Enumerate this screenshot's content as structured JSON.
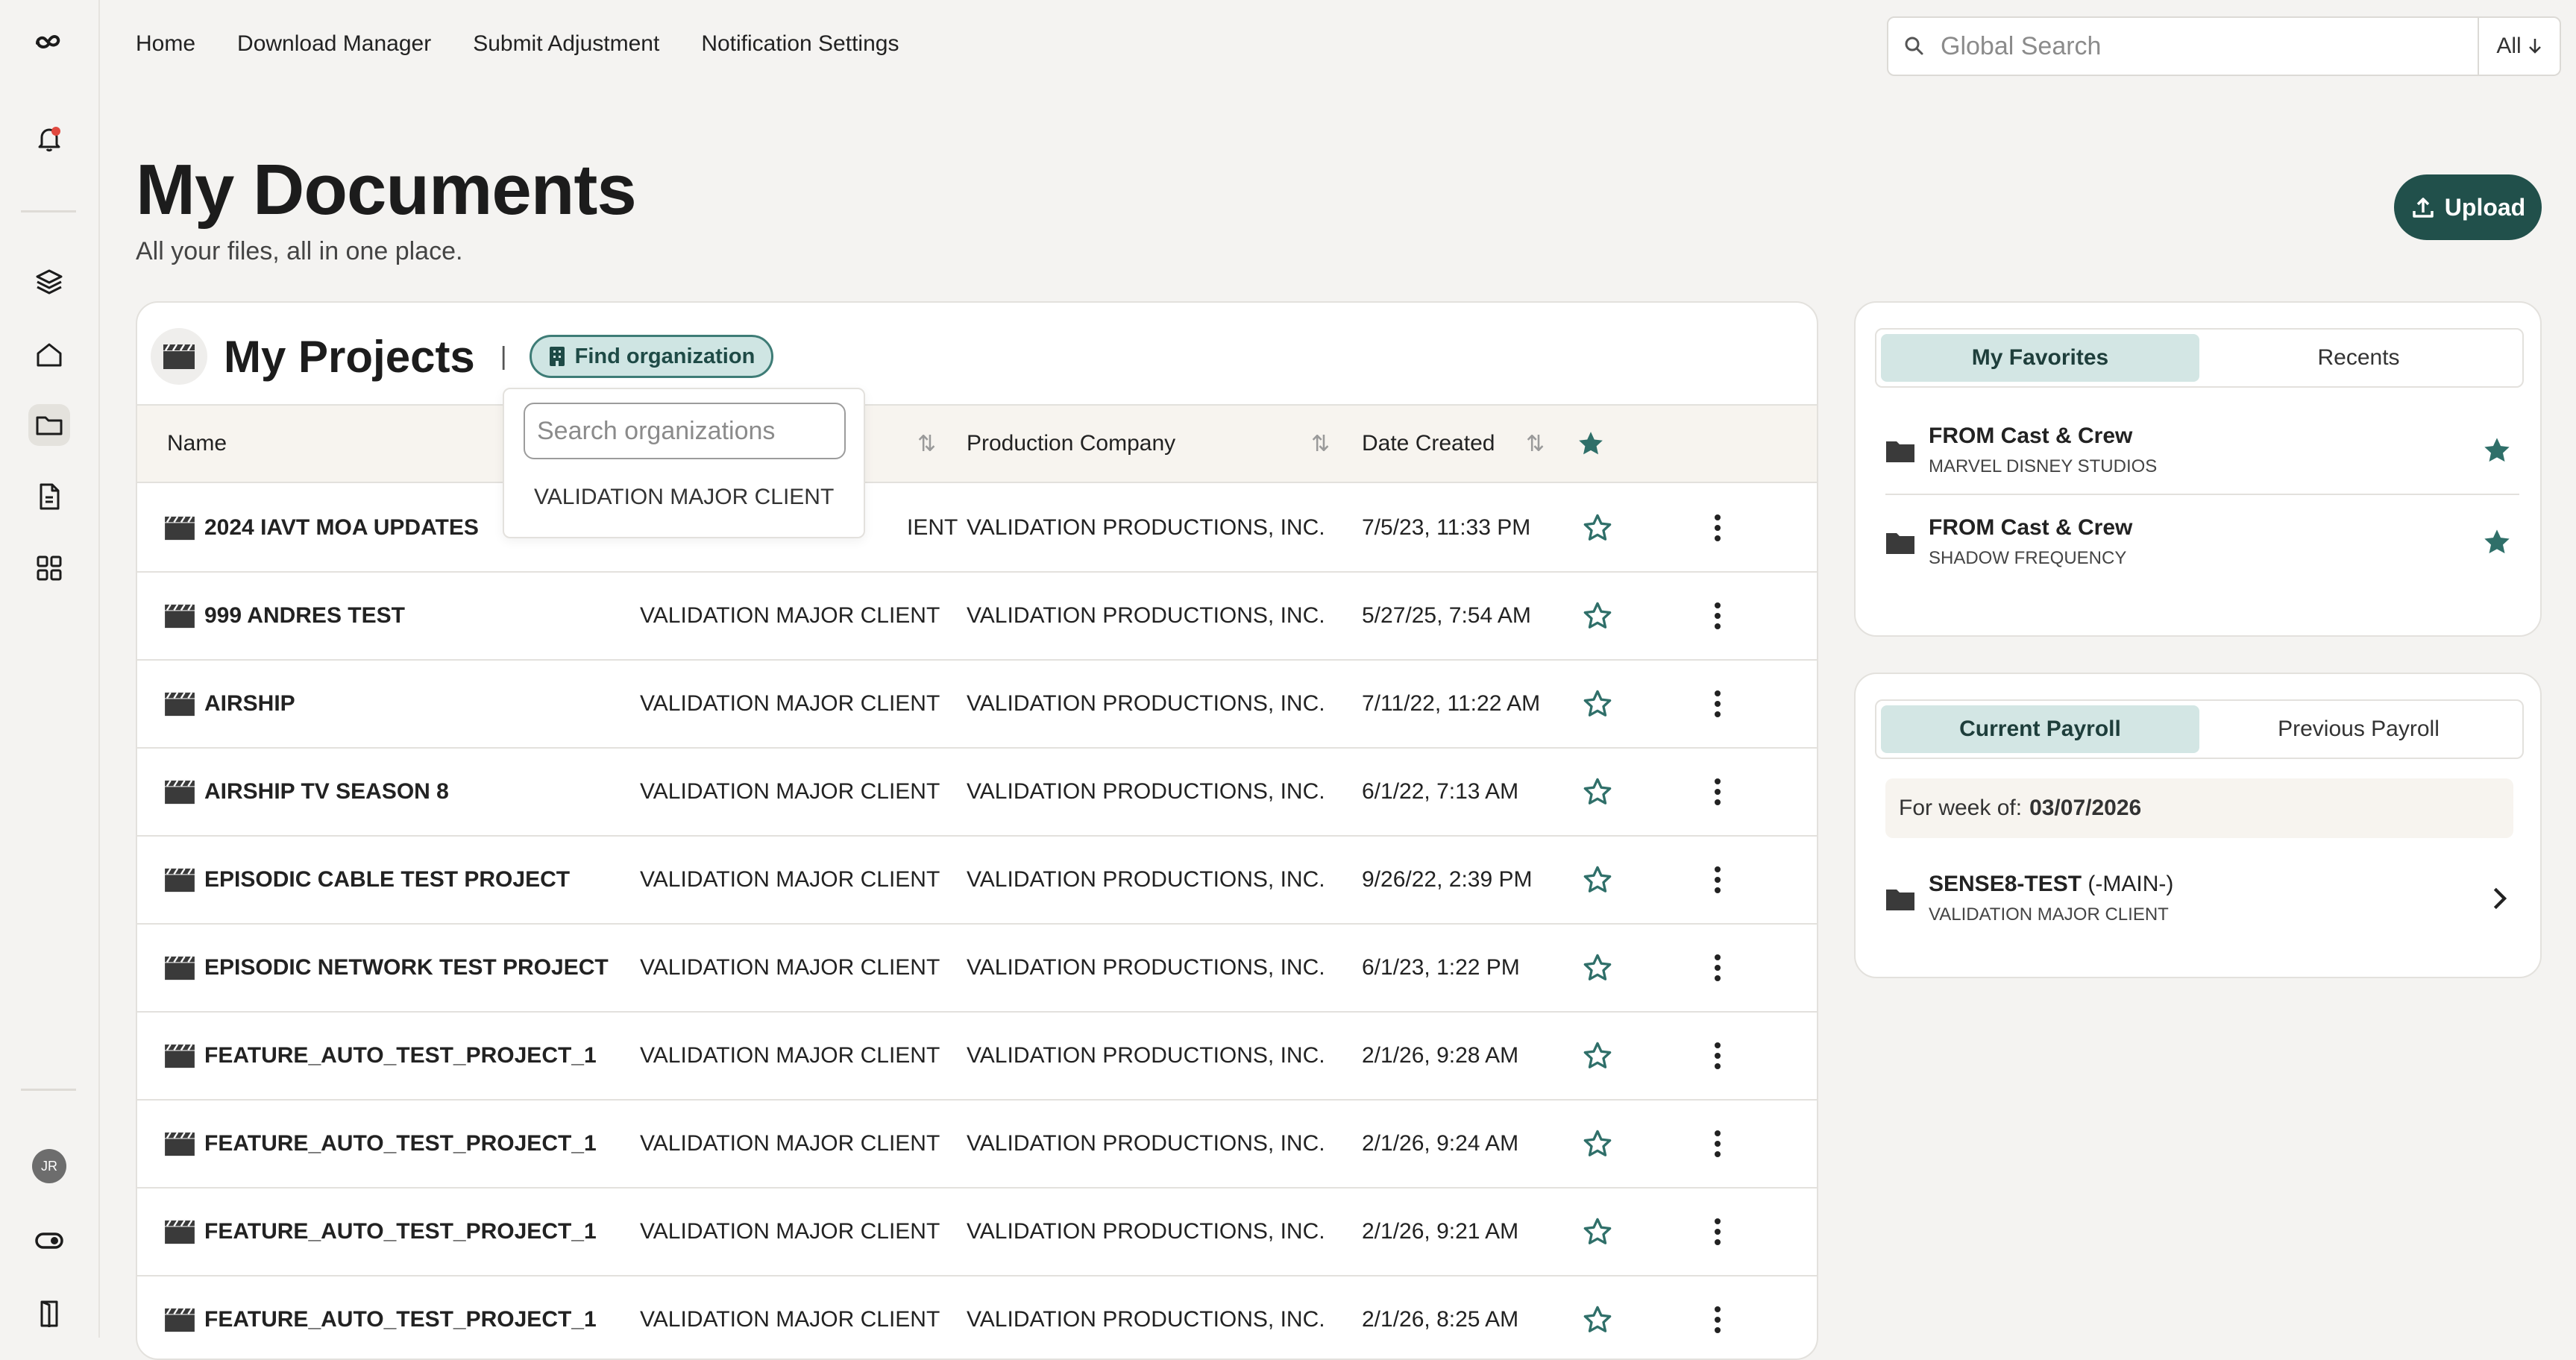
{
  "nav": {
    "items": [
      "Home",
      "Download Manager",
      "Submit Adjustment",
      "Notification Settings"
    ]
  },
  "search": {
    "placeholder": "Global Search",
    "scope": "All"
  },
  "header": {
    "title": "My Documents",
    "subtitle": "All your files, all in one place.",
    "upload_label": "Upload"
  },
  "user": {
    "initials": "JR"
  },
  "projects": {
    "title": "My Projects",
    "find_org_label": "Find organization",
    "dropdown": {
      "placeholder": "Search organizations",
      "options": [
        "VALIDATION MAJOR CLIENT"
      ]
    },
    "columns": {
      "name": "Name",
      "production_company": "Production Company",
      "date_created": "Date Created"
    },
    "rows": [
      {
        "name": "2024 IAVT MOA UPDATES",
        "client": "VALIDATION MAJOR CLIENT",
        "company": "VALIDATION PRODUCTIONS, INC.",
        "date": "7/5/23, 11:33 PM"
      },
      {
        "name": "999 ANDRES TEST",
        "client": "VALIDATION MAJOR CLIENT",
        "company": "VALIDATION PRODUCTIONS, INC.",
        "date": "5/27/25, 7:54 AM"
      },
      {
        "name": "AIRSHIP",
        "client": "VALIDATION MAJOR CLIENT",
        "company": "VALIDATION PRODUCTIONS, INC.",
        "date": "7/11/22, 11:22 AM"
      },
      {
        "name": "AIRSHIP TV SEASON 8",
        "client": "VALIDATION MAJOR CLIENT",
        "company": "VALIDATION PRODUCTIONS, INC.",
        "date": "6/1/22, 7:13 AM"
      },
      {
        "name": "EPISODIC CABLE TEST PROJECT",
        "client": "VALIDATION MAJOR CLIENT",
        "company": "VALIDATION PRODUCTIONS, INC.",
        "date": "9/26/22, 2:39 PM"
      },
      {
        "name": "EPISODIC NETWORK TEST PROJECT",
        "client": "VALIDATION MAJOR CLIENT",
        "company": "VALIDATION PRODUCTIONS, INC.",
        "date": "6/1/23, 1:22 PM"
      },
      {
        "name": "FEATURE_AUTO_TEST_PROJECT_1",
        "client": "VALIDATION MAJOR CLIENT",
        "company": "VALIDATION PRODUCTIONS, INC.",
        "date": "2/1/26, 9:28 AM"
      },
      {
        "name": "FEATURE_AUTO_TEST_PROJECT_1",
        "client": "VALIDATION MAJOR CLIENT",
        "company": "VALIDATION PRODUCTIONS, INC.",
        "date": "2/1/26, 9:24 AM"
      },
      {
        "name": "FEATURE_AUTO_TEST_PROJECT_1",
        "client": "VALIDATION MAJOR CLIENT",
        "company": "VALIDATION PRODUCTIONS, INC.",
        "date": "2/1/26, 9:21 AM"
      },
      {
        "name": "FEATURE_AUTO_TEST_PROJECT_1",
        "client": "VALIDATION MAJOR CLIENT",
        "company": "VALIDATION PRODUCTIONS, INC.",
        "date": "2/1/26, 8:25 AM"
      }
    ],
    "first_row_client_partial": "IENT"
  },
  "favorites": {
    "tabs": [
      "My Favorites",
      "Recents"
    ],
    "items": [
      {
        "title": "FROM Cast & Crew",
        "subtitle": "MARVEL DISNEY STUDIOS"
      },
      {
        "title": "FROM Cast & Crew",
        "subtitle": "SHADOW FREQUENCY"
      }
    ]
  },
  "payroll": {
    "tabs": [
      "Current Payroll",
      "Previous Payroll"
    ],
    "week_label": "For week of:",
    "week_value": "03/07/2026",
    "item": {
      "title": "SENSE8-TEST",
      "suffix": "(-MAIN-)",
      "subtitle": "VALIDATION MAJOR CLIENT"
    }
  },
  "colors": {
    "accent": "#21504b",
    "accent_light": "#d3e6e4",
    "star": "#2f6f69",
    "notification_dot": "#e0483e"
  },
  "icons": [
    "logo-icon",
    "bell-icon",
    "layers-icon",
    "home-icon",
    "folder-icon",
    "document-icon",
    "grid-icon",
    "toggle-icon",
    "logout-icon",
    "search-icon",
    "arrow-down-icon",
    "upload-icon",
    "clapperboard-icon",
    "building-icon",
    "sort-icon",
    "star-icon",
    "kebab-icon",
    "chevron-right-icon"
  ]
}
